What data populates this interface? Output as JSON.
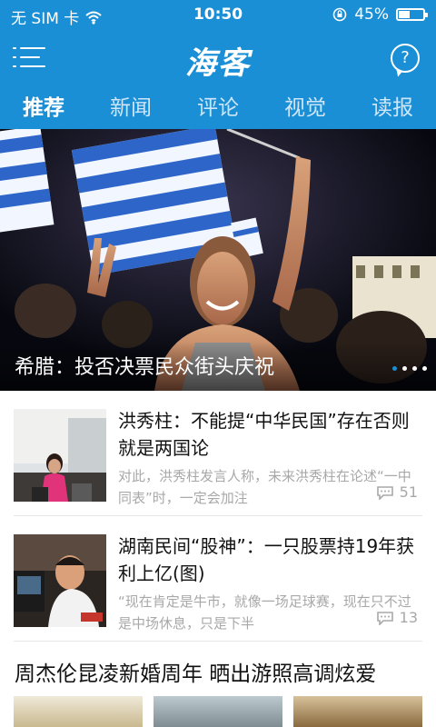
{
  "status_bar": {
    "carrier": "无 SIM 卡",
    "time": "10:50",
    "battery_text": "45%",
    "battery_level": 0.45,
    "icons": [
      "wifi-icon",
      "rotation-lock-icon",
      "battery-icon"
    ]
  },
  "app_bar": {
    "logo_text": "海客",
    "menu_icon": "menu-icon",
    "help_icon": "help-icon"
  },
  "tabs": [
    {
      "label": "推荐",
      "active": true
    },
    {
      "label": "新闻",
      "active": false
    },
    {
      "label": "评论",
      "active": false
    },
    {
      "label": "视觉",
      "active": false
    },
    {
      "label": "读报",
      "active": false
    }
  ],
  "hero": {
    "caption": "希腊：投否决票民众街头庆祝",
    "page_count": 4,
    "active_index": 0
  },
  "news": [
    {
      "title": "洪秀柱：不能提“中华民国”存在否则就是两国论",
      "summary": "对此，洪秀柱发言人称，未来洪秀柱在论述“一中同表”时，一定会加注",
      "comments": "51"
    },
    {
      "title": "湖南民间“股神”：一只股票持19年获利上亿(图)",
      "summary": "“现在肯定是牛市，就像一场足球赛，现在只不过是中场休息，只是下半",
      "comments": "13"
    }
  ],
  "featured": {
    "headline": "周杰伦昆凌新婚周年 晒出游照高调炫爱"
  },
  "colors": {
    "brand": "#1b8fd6",
    "muted_text": "#a8a8a8"
  }
}
